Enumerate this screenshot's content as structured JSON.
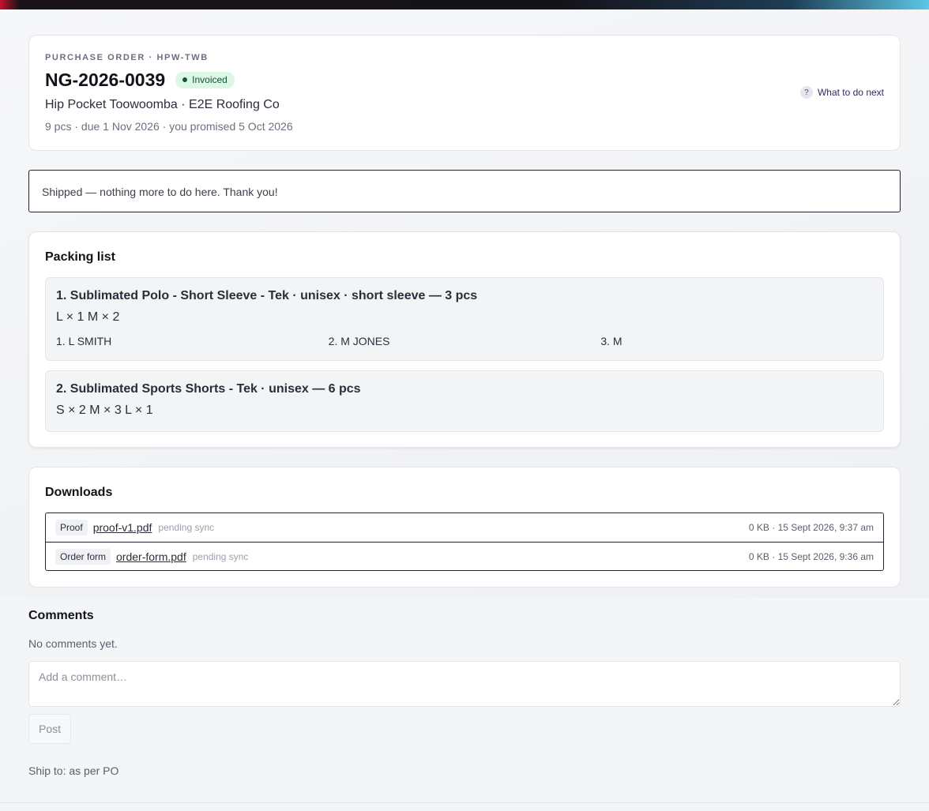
{
  "header": {
    "eyebrow": "PURCHASE ORDER · HPW-TWB",
    "po_number": "NG-2026-0039",
    "status": "Invoiced",
    "customer": "Hip Pocket Toowoomba · E2E Roofing Co",
    "meta": "9 pcs · due 1 Nov 2026 · you promised 5 Oct 2026",
    "help_icon": "?",
    "help_label": "What to do next"
  },
  "notice": "Shipped — nothing more to do here. Thank you!",
  "packing": {
    "title": "Packing list",
    "items": [
      {
        "title": "1. Sublimated Polo - Short Sleeve - Tek · unisex · short sleeve — 3 pcs",
        "sizes": "L × 1 M × 2",
        "names": [
          "1. L SMITH",
          "2. M JONES",
          "3. M"
        ]
      },
      {
        "title": "2. Sublimated Sports Shorts - Tek · unisex — 6 pcs",
        "sizes": "S × 2 M × 3 L × 1"
      }
    ]
  },
  "downloads": {
    "title": "Downloads",
    "files": [
      {
        "tag": "Proof",
        "name": "proof-v1.pdf",
        "status": "pending sync",
        "meta": "0 KB · 15 Sept 2026, 9:37 am"
      },
      {
        "tag": "Order form",
        "name": "order-form.pdf",
        "status": "pending sync",
        "meta": "0 KB · 15 Sept 2026, 9:36 am"
      }
    ]
  },
  "comments": {
    "title": "Comments",
    "empty": "No comments yet.",
    "placeholder": "Add a comment…",
    "post_label": "Post"
  },
  "ship_to": "Ship to: as per PO",
  "colors": {
    "status_bg": "#dcf7e6",
    "status_text": "#14532d",
    "link": "#2e2a6a"
  }
}
